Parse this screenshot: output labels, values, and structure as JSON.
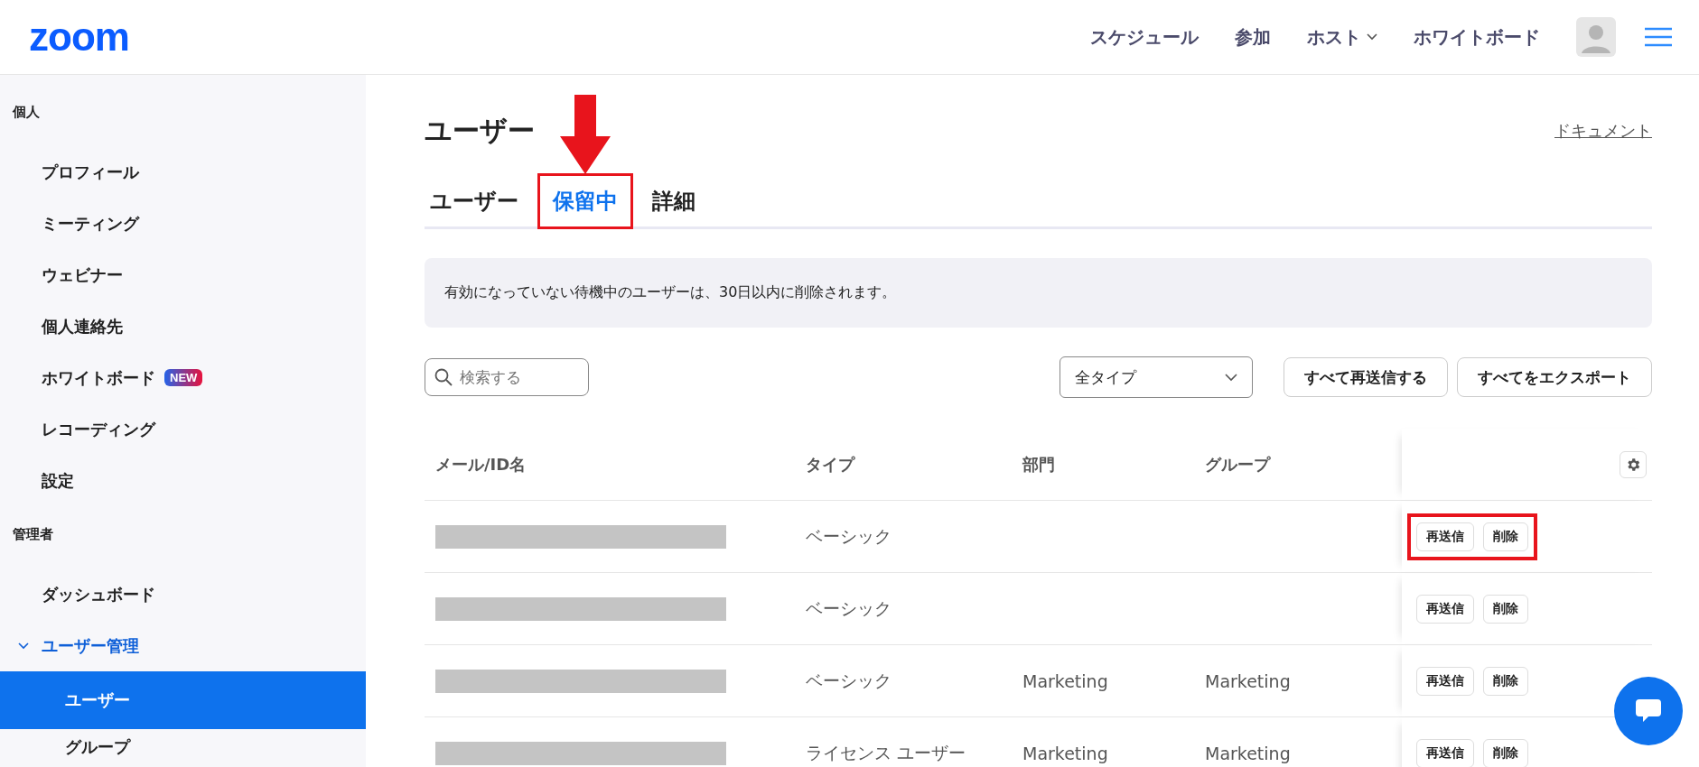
{
  "header": {
    "logo": "zoom",
    "nav": [
      {
        "label": "スケジュール",
        "dropdown": false
      },
      {
        "label": "参加",
        "dropdown": false
      },
      {
        "label": "ホスト",
        "dropdown": true
      },
      {
        "label": "ホワイトボード",
        "dropdown": false
      }
    ]
  },
  "sidebar": {
    "sections": [
      {
        "title": "個人",
        "items": [
          {
            "label": "プロフィール",
            "selected": false
          },
          {
            "label": "ミーティング",
            "selected": false
          },
          {
            "label": "ウェビナー",
            "selected": false
          },
          {
            "label": "個人連絡先",
            "selected": false
          },
          {
            "label": "ホワイトボード",
            "selected": false,
            "badge": "NEW"
          },
          {
            "label": "レコーディング",
            "selected": false
          },
          {
            "label": "設定",
            "selected": false
          }
        ]
      },
      {
        "title": "管理者",
        "items": [
          {
            "label": "ダッシュボード",
            "selected": false
          },
          {
            "label": "ユーザー管理",
            "selected": false,
            "expanded": true,
            "children": [
              {
                "label": "ユーザー",
                "selected": true
              },
              {
                "label": "グループ",
                "selected": false
              }
            ]
          }
        ]
      }
    ]
  },
  "page": {
    "title": "ユーザー",
    "doc_link": "ドキュメント",
    "tabs": [
      {
        "label": "ユーザー",
        "selected": false,
        "highlighted": false
      },
      {
        "label": "保留中",
        "selected": true,
        "highlighted": true
      },
      {
        "label": "詳細",
        "selected": false,
        "highlighted": false
      }
    ],
    "notice": "有効になっていない待機中のユーザーは、30日以内に削除されます。",
    "search": {
      "placeholder": "検索する"
    },
    "type_filter": {
      "value": "全タイプ"
    },
    "buttons": [
      "すべて再送信する",
      "すべてをエクスポート"
    ],
    "table": {
      "columns": [
        "メール/ID名",
        "タイプ",
        "部門",
        "グループ"
      ],
      "rows": [
        {
          "email_redacted": true,
          "type": "ベーシック",
          "department": "",
          "group": "",
          "actions": [
            "再送信",
            "削除"
          ],
          "highlighted": true
        },
        {
          "email_redacted": true,
          "type": "ベーシック",
          "department": "",
          "group": "",
          "actions": [
            "再送信",
            "削除"
          ],
          "highlighted": false
        },
        {
          "email_redacted": true,
          "type": "ベーシック",
          "department": "Marketing",
          "group": "Marketing",
          "actions": [
            "再送信",
            "削除"
          ],
          "highlighted": false
        },
        {
          "email_redacted": true,
          "type": "ライセンス ユーザー",
          "department": "Marketing",
          "group": "Marketing",
          "actions": [
            "再送信",
            "削除"
          ],
          "highlighted": false
        }
      ]
    }
  }
}
